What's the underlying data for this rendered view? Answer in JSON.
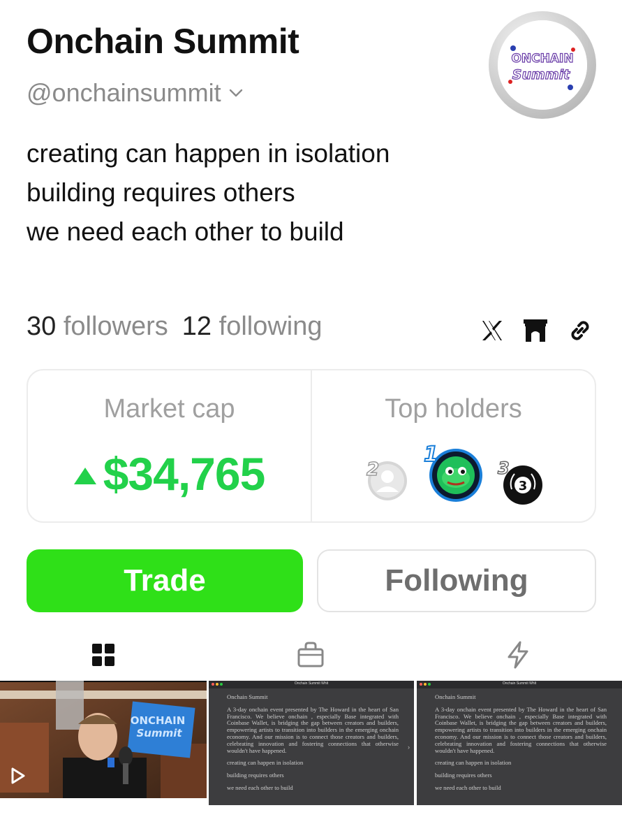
{
  "profile": {
    "display_name": "Onchain Summit",
    "handle": "@onchainsummit",
    "avatar_text_line1": "ONCHAIN",
    "avatar_text_line2": "Summit",
    "bio_lines": [
      "creating can happen in isolation",
      "building requires others",
      "we need each other to build"
    ]
  },
  "follow_stats": {
    "followers_count": "30",
    "followers_label": "followers",
    "following_count": "12",
    "following_label": "following"
  },
  "social_links": [
    {
      "icon": "x-logo-icon"
    },
    {
      "icon": "gateway-arch-icon"
    },
    {
      "icon": "link-icon"
    }
  ],
  "stats": {
    "market_cap_label": "Market cap",
    "market_cap_value": "$34,765",
    "market_cap_trend": "up",
    "top_holders_label": "Top holders",
    "holders": [
      {
        "rank": "2",
        "avatar": "default-person-avatar"
      },
      {
        "rank": "1",
        "avatar": "pepe-frog-avatar"
      },
      {
        "rank": "3",
        "avatar": "laurel-3-avatar"
      }
    ]
  },
  "actions": {
    "trade_label": "Trade",
    "following_label": "Following"
  },
  "tabs": [
    {
      "icon": "grid-icon",
      "active": true
    },
    {
      "icon": "shopping-bag-icon",
      "active": false
    },
    {
      "icon": "lightning-icon",
      "active": false
    }
  ],
  "posts": {
    "video_tile": {
      "type": "video",
      "sign_text_line1": "ONCHAIN",
      "sign_text_line2": "Summit"
    },
    "doc_tile": {
      "window_title": "Onchain Summit Whlt",
      "window_subtitle": "Onchain Summit Pitch",
      "heading": "Onchain Summit",
      "paragraph": "A 3-day onchain  event presented by The Howard in the heart of San Francisco. We believe onchain , especially Base integrated with Coinbase Wallet, is bridging the gap between creators and builders, empowering artists to transition into builders in the emerging onchain  economy. And our mission is to connect those creators and builders, celebrating innovation and fostering connections that otherwise wouldn't have happened.",
      "line1": "creating can happen in isolation",
      "line2": "building requires others",
      "line3": "we need each other to build"
    }
  },
  "colors": {
    "accent_green": "#2fe018",
    "price_green": "#22d14a",
    "muted_text": "#8a8a8a",
    "doc_bg": "#3d3d3f"
  }
}
